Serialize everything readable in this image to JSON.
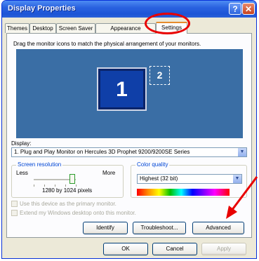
{
  "window": {
    "title": "Display Properties",
    "help_glyph": "?",
    "close_glyph": "✕"
  },
  "tabs": [
    {
      "label": "Themes"
    },
    {
      "label": "Desktop"
    },
    {
      "label": "Screen Saver"
    },
    {
      "label": "Appearance"
    },
    {
      "label": "Settings"
    }
  ],
  "active_tab": "Settings",
  "settings": {
    "instruction": "Drag the monitor icons to match the physical arrangement of your monitors.",
    "monitors": [
      {
        "number": "1",
        "state": "primary"
      },
      {
        "number": "2",
        "state": "inactive"
      }
    ],
    "display_label": "Display:",
    "display_value": "1. Plug and Play Monitor on Hercules 3D Prophet 9200/9200SE Series",
    "resolution": {
      "title": "Screen resolution",
      "less": "Less",
      "more": "More",
      "value": "1280 by 1024 pixels"
    },
    "color_quality": {
      "title": "Color quality",
      "value": "Highest (32 bit)"
    },
    "checkboxes": [
      {
        "label": "Use this device as the primary monitor.",
        "checked": true,
        "enabled": false
      },
      {
        "label": "Extend my Windows desktop onto this monitor.",
        "checked": true,
        "enabled": false
      }
    ],
    "buttons": {
      "identify": "Identify",
      "troubleshoot": "Troubleshoot...",
      "advanced": "Advanced"
    }
  },
  "footer": {
    "ok": "OK",
    "cancel": "Cancel",
    "apply": "Apply"
  },
  "annotations": {
    "color": "#e80000",
    "circle_target": "Settings tab",
    "arrow_target": "Advanced button"
  },
  "colors": {
    "titlebar": "#2a62e0",
    "dialog_bg": "#ece9d8",
    "desktop_preview": "#3a6ea5",
    "tab_highlight": "#e68b2c"
  }
}
